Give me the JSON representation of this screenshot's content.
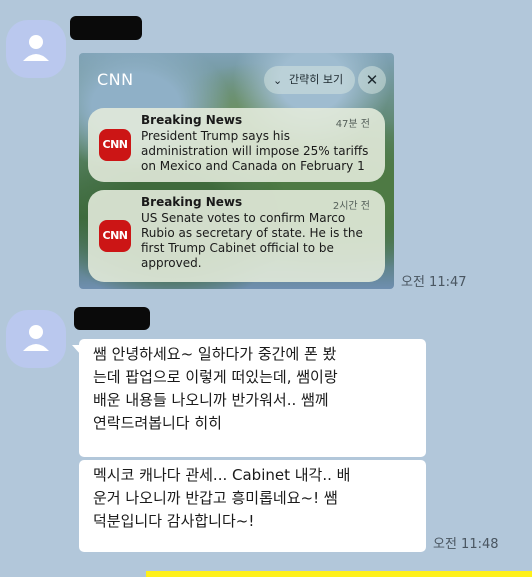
{
  "message1": {
    "screenshot": {
      "app_name": "CNN",
      "collapse_label": "간략히 보기",
      "close_symbol": "✕",
      "notifications": [
        {
          "icon_text": "CNN",
          "title": "Breaking News",
          "time": "47분 전",
          "body": "President Trump says his administration will impose 25% tariffs on Mexico and Canada on February 1"
        },
        {
          "icon_text": "CNN",
          "title": "Breaking News",
          "time": "2시간 전",
          "body": "US Senate votes to confirm Marco Rubio as secretary of state. He is the first Trump Cabinet official to be approved."
        }
      ]
    },
    "timestamp": "오전 11:47"
  },
  "message2": {
    "bubbles": [
      {
        "lines": [
          "쌤 안녕하세요~ 일하다가 중간에 폰 봤",
          "는데 팝업으로 이렇게 떠있는데, 쌤이랑",
          "배운 내용들 나오니까 반가워서.. 쌤께",
          "연락드려봅니다 히히"
        ]
      },
      {
        "lines": [
          "멕시코 캐나다 관세... Cabinet 내각.. 배",
          "운거 나오니까 반갑고 흥미롭네요~! 쌤",
          "덕분입니다 감사합니다~!"
        ]
      }
    ],
    "timestamp": "오전 11:48"
  },
  "colors": {
    "chat_background": "#b2c7da",
    "avatar": "#bac8ee",
    "bubble": "#ffffff",
    "cnn_red": "#cc1515",
    "own_bubble_yellow": "#fef01b"
  },
  "icons": [
    "profile-avatar-icon",
    "chevron-down-icon",
    "close-icon",
    "cnn-logo-icon"
  ]
}
